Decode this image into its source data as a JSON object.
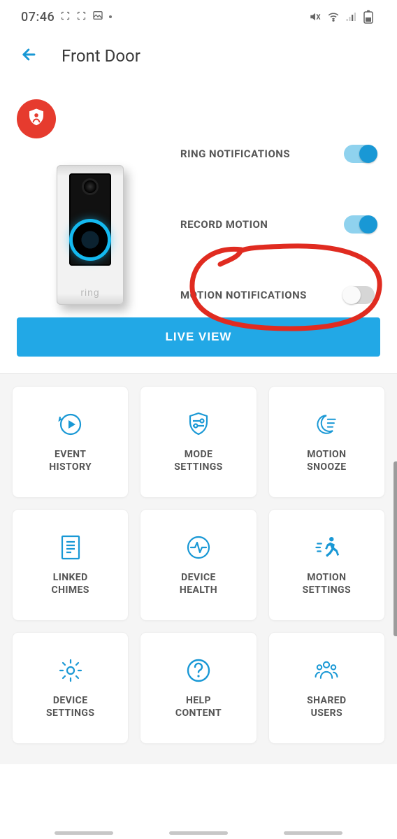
{
  "status_bar": {
    "time": "07:46",
    "icons": {
      "capture1": "capture-icon",
      "capture2": "capture-icon",
      "picture": "picture-icon",
      "mute": "volume-mute-icon",
      "wifi": "wifi-icon",
      "signal": "signal-icon",
      "battery": "battery-icon"
    }
  },
  "header": {
    "title": "Front Door",
    "back_icon": "back-arrow-icon"
  },
  "device": {
    "badge_icon": "shield-person-icon",
    "brand": "ring",
    "toggles": [
      {
        "label": "RING NOTIFICATIONS",
        "on": true
      },
      {
        "label": "RECORD MOTION",
        "on": true
      },
      {
        "label": "MOTION NOTIFICATIONS",
        "on": false
      }
    ]
  },
  "live_view_label": "LIVE VIEW",
  "annotation_color": "#e02b20",
  "cards": [
    {
      "id": "event-history",
      "label": "EVENT\nHISTORY",
      "icon": "history-play-icon"
    },
    {
      "id": "mode-settings",
      "label": "MODE\nSETTINGS",
      "icon": "shield-sliders-icon"
    },
    {
      "id": "motion-snooze",
      "label": "MOTION\nSNOOZE",
      "icon": "moon-snooze-icon"
    },
    {
      "id": "linked-chimes",
      "label": "LINKED\nCHIMES",
      "icon": "document-lines-icon"
    },
    {
      "id": "device-health",
      "label": "DEVICE\nHEALTH",
      "icon": "heartbeat-icon"
    },
    {
      "id": "motion-settings",
      "label": "MOTION\nSETTINGS",
      "icon": "running-person-icon"
    },
    {
      "id": "device-settings",
      "label": "DEVICE\nSETTINGS",
      "icon": "gear-icon"
    },
    {
      "id": "help-content",
      "label": "HELP\nCONTENT",
      "icon": "question-circle-icon"
    },
    {
      "id": "shared-users",
      "label": "SHARED\nUSERS",
      "icon": "users-group-icon"
    }
  ]
}
